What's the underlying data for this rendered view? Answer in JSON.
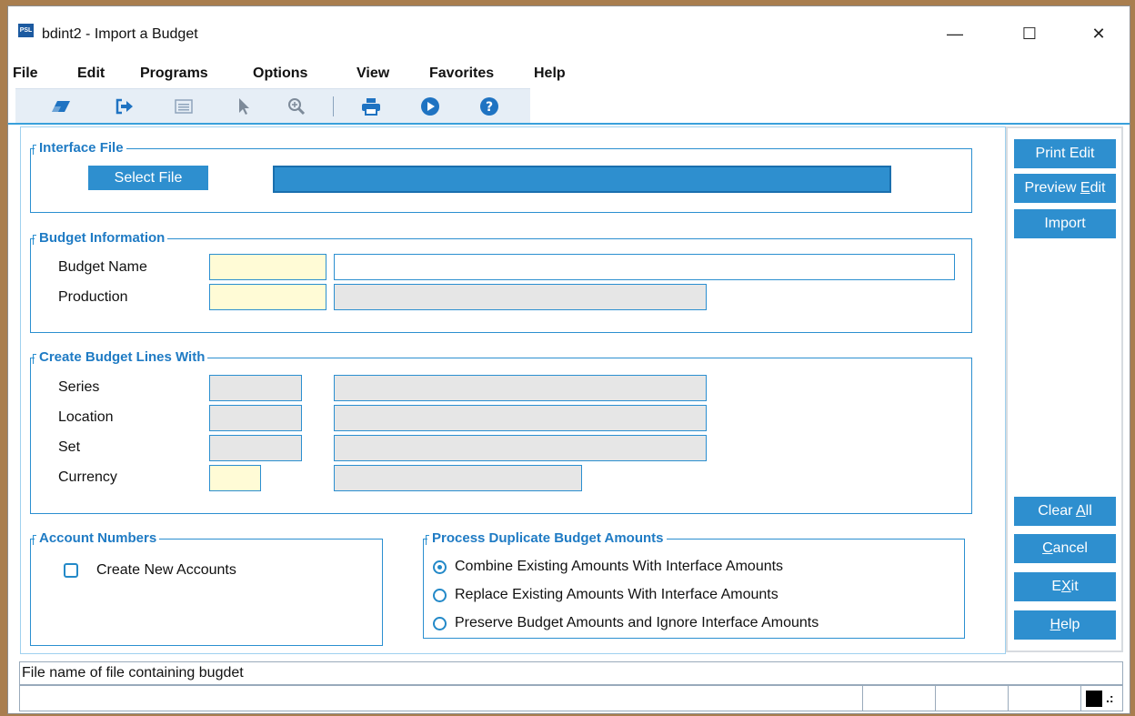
{
  "window": {
    "icon_text": "PSL",
    "title": "bdint2 - Import a Budget",
    "controls": {
      "minimize": "—",
      "maximize": "☐",
      "close": "✕"
    }
  },
  "menu": [
    "File",
    "Edit",
    "Programs",
    "Options",
    "View",
    "Favorites",
    "Help"
  ],
  "toolbar_icons": [
    "eraser-icon",
    "exit-arrow-icon",
    "list-icon",
    "pointer-icon",
    "zoom-icon",
    "print-icon",
    "play-icon",
    "help-icon"
  ],
  "interface_file": {
    "title": "Interface File",
    "select_button": "Select File",
    "path_value": ""
  },
  "budget_information": {
    "title": "Budget Information",
    "budget_name_label": "Budget Name",
    "production_label": "Production",
    "budget_name_code": "",
    "budget_name_desc": "",
    "production_code": "",
    "production_desc": ""
  },
  "create_budget_lines": {
    "title": "Create Budget Lines With",
    "series_label": "Series",
    "location_label": "Location",
    "set_label": "Set",
    "currency_label": "Currency"
  },
  "account_numbers": {
    "title": "Account Numbers",
    "create_new_label": "Create New Accounts",
    "create_new_checked": false
  },
  "process_duplicate": {
    "title": "Process Duplicate Budget Amounts",
    "options": [
      "Combine Existing Amounts With Interface Amounts",
      "Replace Existing Amounts With Interface Amounts",
      "Preserve Budget Amounts and Ignore Interface Amounts"
    ],
    "selected_index": 0
  },
  "side_buttons": {
    "print_edit": "Print Edit",
    "preview_edit_pre": "Preview ",
    "preview_edit_u": "E",
    "preview_edit_post": "dit",
    "import": "Import",
    "clear_all_pre": "Clear ",
    "clear_all_u": "A",
    "clear_all_post": "ll",
    "cancel_u": "C",
    "cancel_post": "ancel",
    "exit_pre": "E",
    "exit_u": "X",
    "exit_post": "it",
    "help_u": "H",
    "help_post": "elp"
  },
  "status": {
    "message": "File name of file containing bugdet"
  },
  "colors": {
    "accent": "#2e8fcf",
    "required_field": "#fffbd6",
    "readonly_field": "#e6e6e6"
  }
}
